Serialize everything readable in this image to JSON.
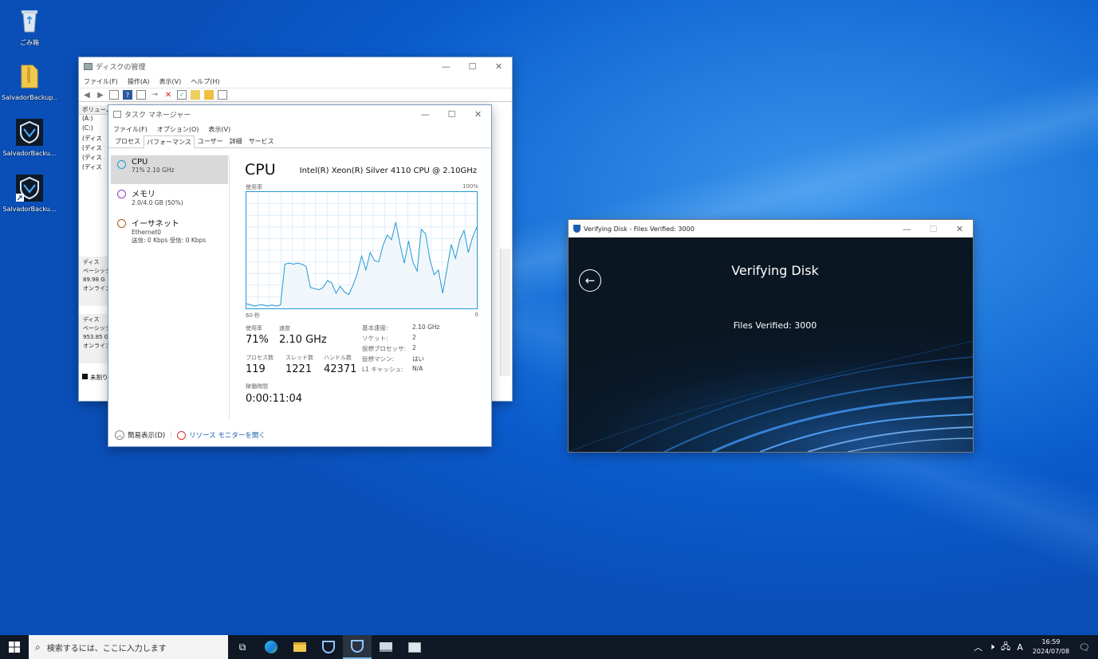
{
  "desktop": {
    "icons": [
      {
        "label": "ごみ箱",
        "icon": "recycle-bin-icon"
      },
      {
        "label": "SalvadorBackup...",
        "icon": "folder-icon"
      },
      {
        "label": "SalvadorBacku...",
        "icon": "salvador-app-icon"
      },
      {
        "label": "SalvadorBacku...",
        "icon": "salvador-shortcut-icon"
      }
    ]
  },
  "disk_mgmt": {
    "title": "ディスクの管理",
    "menu": [
      "ファイル(F)",
      "操作(A)",
      "表示(V)",
      "ヘルプ(H)"
    ],
    "vol_header": "ボリューム",
    "volumes": [
      "(A:)",
      "(C:)",
      "(ディス",
      "(ディス",
      "(ディス",
      "(ディス"
    ],
    "disks": [
      {
        "name": "ディス",
        "type": "ベーシック",
        "size": "89.98 G",
        "status": "オンライン"
      },
      {
        "name": "ディス",
        "type": "ベーシック",
        "size": "953.85 G",
        "status": "オンライン"
      }
    ],
    "legend": "未割り"
  },
  "task_manager": {
    "title": "タスク マネージャー",
    "menu": [
      "ファイル(F)",
      "オプション(O)",
      "表示(V)"
    ],
    "tabs": [
      "プロセス",
      "パフォーマンス",
      "ユーザー",
      "詳細",
      "サービス"
    ],
    "active_tab": "パフォーマンス",
    "resources": [
      {
        "name": "CPU",
        "detail": "71% 2.10 GHz",
        "detail2": "",
        "color": "#1f9ad6"
      },
      {
        "name": "メモリ",
        "detail": "2.0/4.0 GB (50%)",
        "detail2": "",
        "color": "#8b3fb3"
      },
      {
        "name": "イーサネット",
        "detail": "Ethernet0",
        "detail2": "送信: 0 Kbps 受信: 0 Kbps",
        "color": "#a75f16"
      }
    ],
    "cpu_title": "CPU",
    "cpu_name": "Intel(R) Xeon(R) Silver 4110 CPU @ 2.10GHz",
    "graph_label": "使用率",
    "graph_max": "100%",
    "graph_time": "60 秒",
    "graph_min": "0",
    "usage_label": "使用率",
    "usage_value": "71%",
    "speed_label": "速度",
    "speed_value": "2.10 GHz",
    "processes_label": "プロセス数",
    "processes_value": "119",
    "threads_label": "スレッド数",
    "threads_value": "1221",
    "handles_label": "ハンドル数",
    "handles_value": "42371",
    "uptime_label": "稼働時間",
    "uptime_value": "0:00:11:04",
    "specs": [
      {
        "k": "基本速度:",
        "v": "2.10 GHz"
      },
      {
        "k": "ソケット:",
        "v": "2"
      },
      {
        "k": "仮想プロセッサ:",
        "v": "2"
      },
      {
        "k": "仮想マシン:",
        "v": "はい"
      },
      {
        "k": "L1 キャッシュ:",
        "v": "N/A"
      }
    ],
    "fewer_details": "簡易表示(D)",
    "resource_monitor": "リソース モニターを開く"
  },
  "chart_data": {
    "type": "area",
    "title": "",
    "xlabel": "60 秒",
    "ylabel": "使用率",
    "ylim": [
      0,
      100
    ],
    "series": [
      {
        "values": [
          4,
          3,
          2,
          3,
          3,
          2,
          3,
          2,
          3,
          38,
          39,
          38,
          39,
          38,
          36,
          18,
          17,
          16,
          18,
          24,
          22,
          13,
          19,
          14,
          12,
          20,
          30,
          45,
          33,
          48,
          41,
          40,
          54,
          63,
          59,
          74,
          55,
          39,
          58,
          40,
          32,
          68,
          64,
          42,
          29,
          33,
          13,
          34,
          55,
          43,
          59,
          67,
          48,
          61,
          70
        ]
      }
    ]
  },
  "verify": {
    "window_title": "Verifying Disk - Files Verified: 3000",
    "heading": "Verifying Disk",
    "count_text": "Files Verified: 3000"
  },
  "taskbar": {
    "search_placeholder": "検索するには、ここに入力します",
    "time": "16:59",
    "date": "2024/07/08",
    "ime": "A"
  }
}
